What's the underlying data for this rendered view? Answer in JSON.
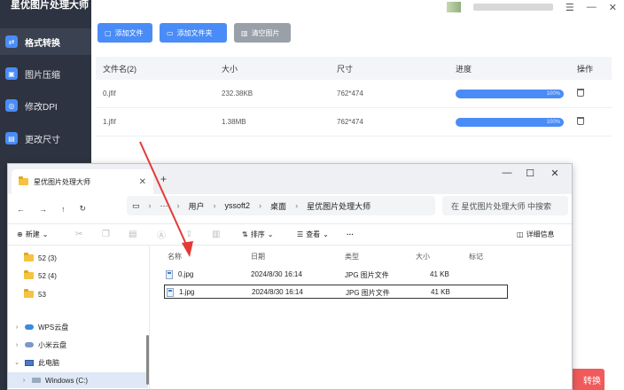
{
  "app": {
    "title": "星优图片处理大师",
    "sidebar": [
      {
        "label": "格式转换",
        "icon": "format-convert-icon"
      },
      {
        "label": "图片压缩",
        "icon": "compress-icon"
      },
      {
        "label": "修改DPI",
        "icon": "dpi-icon"
      },
      {
        "label": "更改尺寸",
        "icon": "resize-icon"
      }
    ],
    "toolbar": {
      "add_file": "添加文件",
      "add_folder": "添加文件夹",
      "clear": "清空图片"
    },
    "table": {
      "headers": [
        "文件名(2)",
        "大小",
        "尺寸",
        "进度",
        "操作"
      ],
      "rows": [
        {
          "name": "0.jfif",
          "size": "232.38KB",
          "dims": "762*474",
          "progress": "100%"
        },
        {
          "name": "1.jfif",
          "size": "1.38MB",
          "dims": "762*474",
          "progress": "100%"
        }
      ]
    },
    "start_button": "转换"
  },
  "explorer": {
    "tab_title": "星优图片处理大师",
    "breadcrumb": [
      "用户",
      "yssoft2",
      "桌面",
      "星优图片处理大师"
    ],
    "search_placeholder": "在 星优图片处理大师 中搜索",
    "commands": {
      "new": "新建",
      "sort": "排序",
      "view": "查看",
      "more": "···",
      "details": "详细信息"
    },
    "nav": [
      {
        "label": "52 (3)",
        "type": "folder"
      },
      {
        "label": "52 (4)",
        "type": "folder"
      },
      {
        "label": "53",
        "type": "folder"
      },
      {
        "label": "WPS云盘",
        "type": "cloud"
      },
      {
        "label": "小米云盘",
        "type": "cloud"
      },
      {
        "label": "此电脑",
        "type": "pc"
      },
      {
        "label": "Windows (C:)",
        "type": "drive"
      }
    ],
    "columns": [
      "名称",
      "日期",
      "类型",
      "大小",
      "标记"
    ],
    "files": [
      {
        "name": "0.jpg",
        "date": "2024/8/30 16:14",
        "type": "JPG 图片文件",
        "size": "41 KB"
      },
      {
        "name": "1.jpg",
        "date": "2024/8/30 16:14",
        "type": "JPG 图片文件",
        "size": "41 KB"
      }
    ]
  },
  "colors": {
    "accent": "#4a8cf7",
    "sidebar_bg": "#2d3340",
    "danger": "#f05a5a",
    "arrow": "#e53935"
  }
}
